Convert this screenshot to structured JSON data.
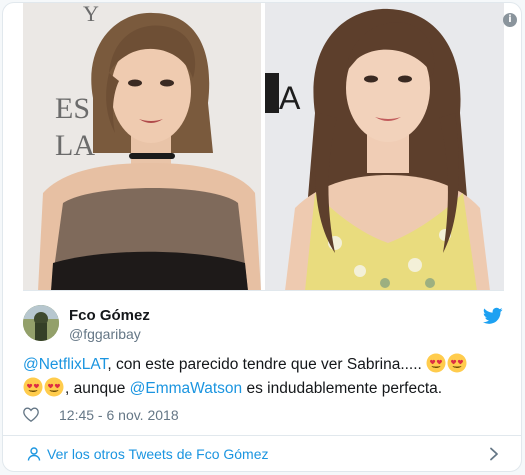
{
  "tweet": {
    "author_name": "Fco Gómez",
    "author_handle": "@fggaribay",
    "text_before": ", con este parecido tendre que ver Sabrina.....",
    "text_middle": ", aunque",
    "text_after": "es indudablemente perfecta.",
    "mention_1": "@NetflixLAT",
    "mention_2": "@EmmaWatson",
    "timestamp": "12:45 - 6 nov. 2018"
  },
  "media": {
    "left_backdrop_text": "ES\nLA",
    "right_backdrop_text": "A",
    "info_glyph": "i"
  },
  "footer": {
    "more_tweets_label": "Ver los otros Tweets de Fco Gómez"
  },
  "icons": {
    "verified_bird": "twitter-bird-icon",
    "like": "heart-icon",
    "more": "chevron-right-icon",
    "person": "person-icon",
    "emoji": "heart-eyes-emoji-icon"
  },
  "colors": {
    "link": "#1b95e0",
    "text": "#14171a",
    "secondary": "#657786",
    "border": "#e1e8ed"
  }
}
